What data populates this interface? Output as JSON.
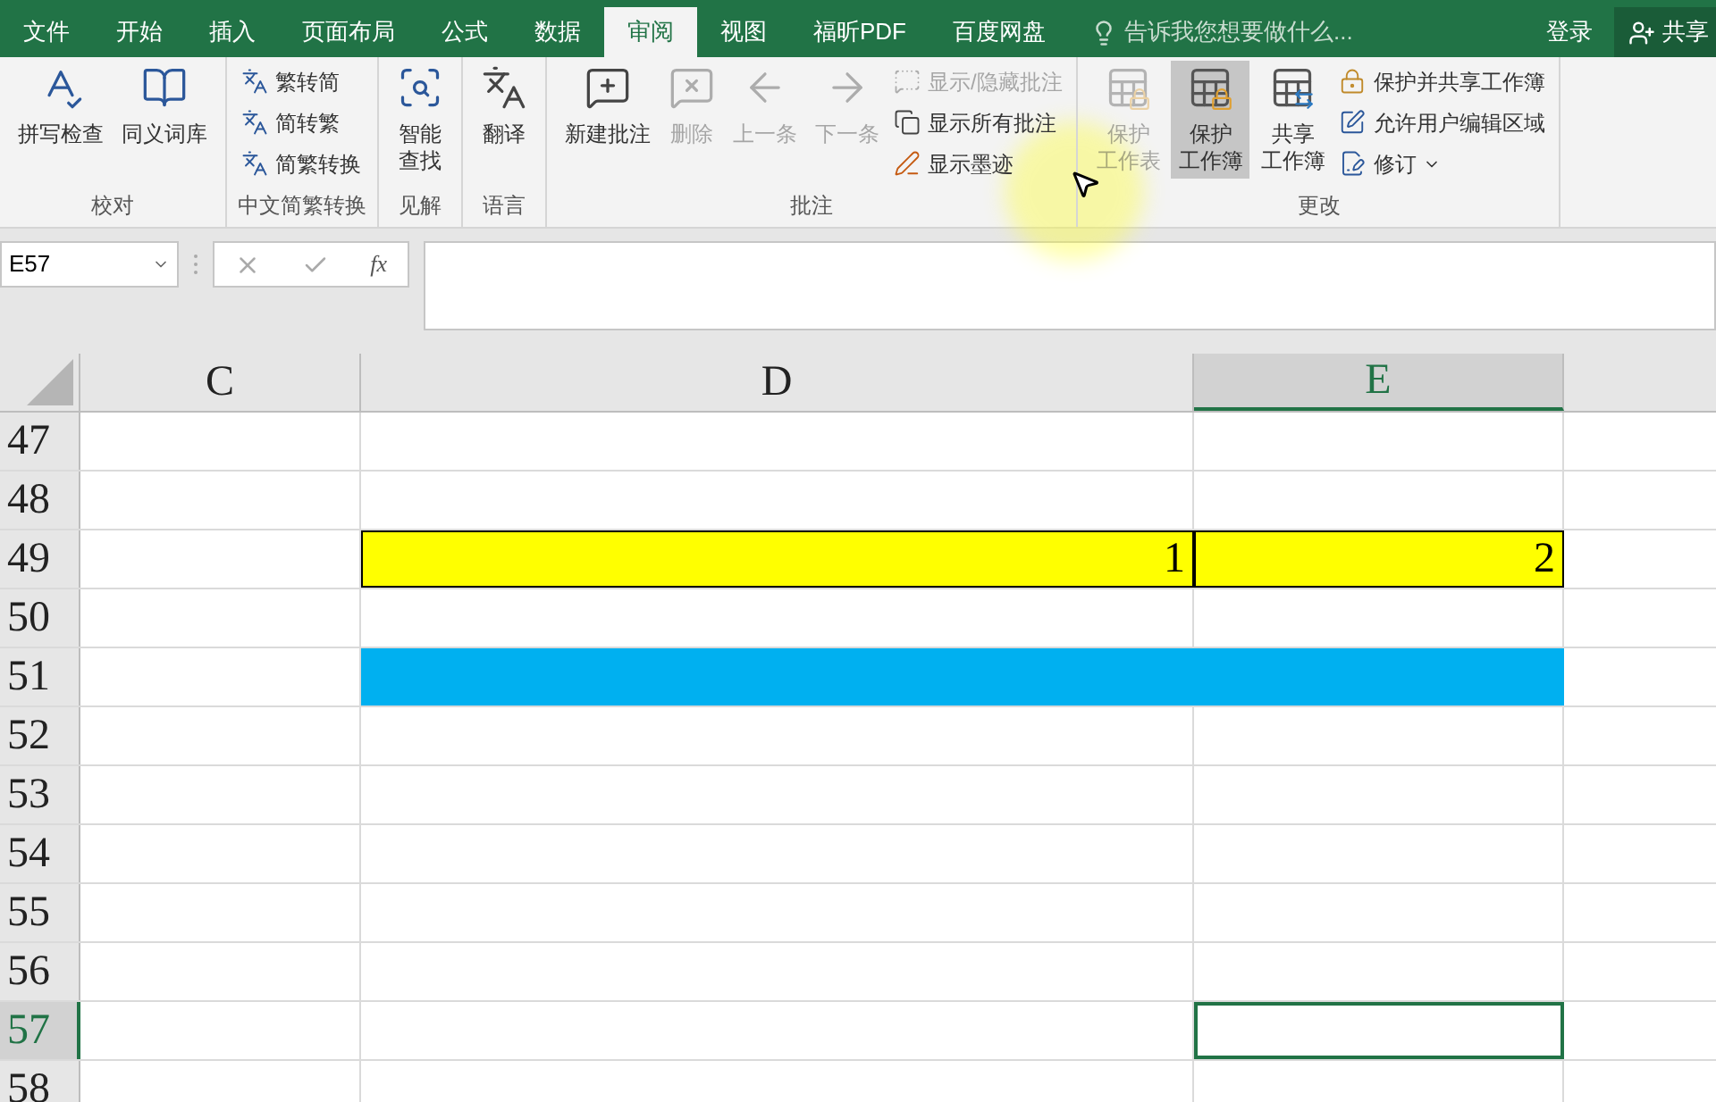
{
  "tabs": [
    {
      "label": "文件",
      "selected": false
    },
    {
      "label": "开始",
      "selected": false
    },
    {
      "label": "插入",
      "selected": false
    },
    {
      "label": "页面布局",
      "selected": false
    },
    {
      "label": "公式",
      "selected": false
    },
    {
      "label": "数据",
      "selected": false
    },
    {
      "label": "审阅",
      "selected": true
    },
    {
      "label": "视图",
      "selected": false
    },
    {
      "label": "福昕PDF",
      "selected": false
    },
    {
      "label": "百度网盘",
      "selected": false
    }
  ],
  "tell_me": {
    "placeholder": "告诉我您想要做什么..."
  },
  "sign_in": "登录",
  "share": "共享",
  "ribbon_groups": [
    {
      "label": "校对",
      "items": [
        {
          "kind": "large",
          "label": "拼写检查",
          "disabled": false,
          "pressed": false
        },
        {
          "kind": "large",
          "label": "同义词库",
          "disabled": false,
          "pressed": false
        }
      ]
    },
    {
      "label": "中文简繁转换",
      "items": [
        {
          "kind": "small",
          "label": "繁转简",
          "disabled": false,
          "pressed": false
        },
        {
          "kind": "small",
          "label": "简转繁",
          "disabled": false,
          "pressed": false
        },
        {
          "kind": "small",
          "label": "简繁转换",
          "disabled": false,
          "pressed": false
        }
      ]
    },
    {
      "label": "见解",
      "items": [
        {
          "kind": "large",
          "lines": [
            "智能",
            "查找"
          ],
          "disabled": false,
          "pressed": false
        }
      ]
    },
    {
      "label": "语言",
      "items": [
        {
          "kind": "large",
          "label": "翻译",
          "disabled": false,
          "pressed": false
        }
      ]
    },
    {
      "label": "批注",
      "items": [
        {
          "kind": "large",
          "label": "新建批注",
          "disabled": false,
          "pressed": false
        },
        {
          "kind": "large",
          "label": "删除",
          "disabled": true,
          "pressed": false
        },
        {
          "kind": "large",
          "label": "上一条",
          "disabled": true,
          "pressed": false
        },
        {
          "kind": "large",
          "label": "下一条",
          "disabled": true,
          "pressed": false
        },
        {
          "kind": "small",
          "label": "显示/隐藏批注",
          "disabled": true,
          "pressed": false
        },
        {
          "kind": "small",
          "label": "显示所有批注",
          "disabled": false,
          "pressed": false
        },
        {
          "kind": "small",
          "label": "显示墨迹",
          "disabled": false,
          "pressed": false
        }
      ]
    },
    {
      "label": "更改",
      "items": [
        {
          "kind": "large",
          "lines": [
            "保护",
            "工作表"
          ],
          "disabled": true,
          "pressed": false
        },
        {
          "kind": "large",
          "lines": [
            "保护",
            "工作簿"
          ],
          "disabled": false,
          "pressed": true
        },
        {
          "kind": "large",
          "lines": [
            "共享",
            "工作簿"
          ],
          "disabled": false,
          "pressed": false
        },
        {
          "kind": "small",
          "label": "保护并共享工作簿",
          "disabled": false,
          "pressed": false
        },
        {
          "kind": "small",
          "label": "允许用户编辑区域",
          "disabled": false,
          "pressed": false
        },
        {
          "kind": "small",
          "label": "修订",
          "disabled": false,
          "pressed": false,
          "dropdown": true
        }
      ]
    }
  ],
  "formula_bar": {
    "name_box": "E57",
    "function_label": "fx"
  },
  "columns": [
    {
      "label": "C",
      "selected": false
    },
    {
      "label": "D",
      "selected": false
    },
    {
      "label": "E",
      "selected": true
    }
  ],
  "rows": [
    {
      "label": "47",
      "selected": false,
      "cells": [
        {
          "selected": false
        },
        {
          "selected": false
        },
        {
          "selected": false
        }
      ]
    },
    {
      "label": "48",
      "selected": false,
      "cells": [
        {
          "selected": false
        },
        {
          "selected": false
        },
        {
          "selected": false
        }
      ]
    },
    {
      "label": "49",
      "selected": false,
      "cells": [
        {
          "selected": false
        },
        {
          "value": "1",
          "color": "#ffff00",
          "selected": false
        },
        {
          "value": "2",
          "color": "#ffff00",
          "selected": false
        }
      ]
    },
    {
      "label": "50",
      "selected": false,
      "cells": [
        {
          "selected": false
        },
        {
          "selected": false
        },
        {
          "selected": false
        }
      ]
    },
    {
      "label": "51",
      "selected": false,
      "cells": [
        {
          "selected": false
        },
        {
          "color": "#00b0f0",
          "selected": false
        },
        {
          "color": "#00b0f0",
          "selected": false
        }
      ]
    },
    {
      "label": "52",
      "selected": false,
      "cells": [
        {
          "selected": false
        },
        {
          "selected": false
        },
        {
          "selected": false
        }
      ]
    },
    {
      "label": "53",
      "selected": false,
      "cells": [
        {
          "selected": false
        },
        {
          "selected": false
        },
        {
          "selected": false
        }
      ]
    },
    {
      "label": "54",
      "selected": false,
      "cells": [
        {
          "selected": false
        },
        {
          "selected": false
        },
        {
          "selected": false
        }
      ]
    },
    {
      "label": "55",
      "selected": false,
      "cells": [
        {
          "selected": false
        },
        {
          "selected": false
        },
        {
          "selected": false
        }
      ]
    },
    {
      "label": "56",
      "selected": false,
      "cells": [
        {
          "selected": false
        },
        {
          "selected": false
        },
        {
          "selected": false
        }
      ]
    },
    {
      "label": "57",
      "selected": true,
      "cells": [
        {
          "selected": false
        },
        {
          "selected": false
        },
        {
          "selected": true
        }
      ]
    },
    {
      "label": "58",
      "selected": false,
      "cells": [
        {
          "selected": false
        },
        {
          "selected": false
        },
        {
          "selected": false
        }
      ]
    }
  ]
}
